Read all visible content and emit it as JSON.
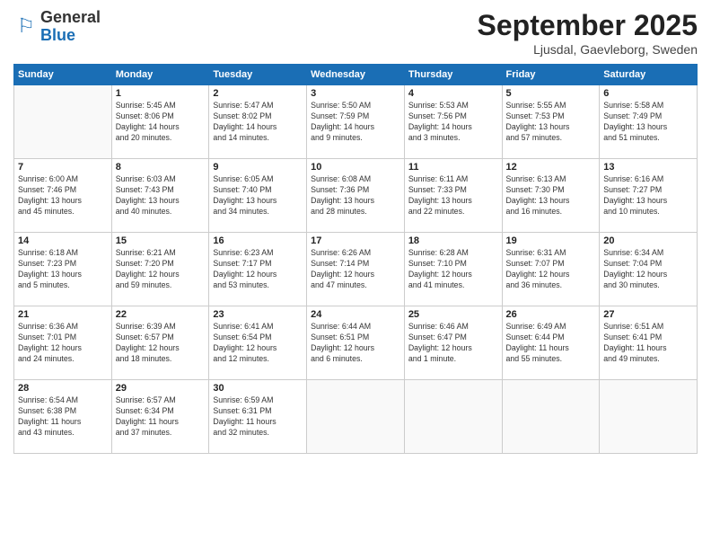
{
  "header": {
    "logo_line1": "General",
    "logo_line2": "Blue",
    "month": "September 2025",
    "location": "Ljusdal, Gaevleborg, Sweden"
  },
  "weekdays": [
    "Sunday",
    "Monday",
    "Tuesday",
    "Wednesday",
    "Thursday",
    "Friday",
    "Saturday"
  ],
  "weeks": [
    [
      {
        "day": "",
        "info": ""
      },
      {
        "day": "1",
        "info": "Sunrise: 5:45 AM\nSunset: 8:06 PM\nDaylight: 14 hours\nand 20 minutes."
      },
      {
        "day": "2",
        "info": "Sunrise: 5:47 AM\nSunset: 8:02 PM\nDaylight: 14 hours\nand 14 minutes."
      },
      {
        "day": "3",
        "info": "Sunrise: 5:50 AM\nSunset: 7:59 PM\nDaylight: 14 hours\nand 9 minutes."
      },
      {
        "day": "4",
        "info": "Sunrise: 5:53 AM\nSunset: 7:56 PM\nDaylight: 14 hours\nand 3 minutes."
      },
      {
        "day": "5",
        "info": "Sunrise: 5:55 AM\nSunset: 7:53 PM\nDaylight: 13 hours\nand 57 minutes."
      },
      {
        "day": "6",
        "info": "Sunrise: 5:58 AM\nSunset: 7:49 PM\nDaylight: 13 hours\nand 51 minutes."
      }
    ],
    [
      {
        "day": "7",
        "info": "Sunrise: 6:00 AM\nSunset: 7:46 PM\nDaylight: 13 hours\nand 45 minutes."
      },
      {
        "day": "8",
        "info": "Sunrise: 6:03 AM\nSunset: 7:43 PM\nDaylight: 13 hours\nand 40 minutes."
      },
      {
        "day": "9",
        "info": "Sunrise: 6:05 AM\nSunset: 7:40 PM\nDaylight: 13 hours\nand 34 minutes."
      },
      {
        "day": "10",
        "info": "Sunrise: 6:08 AM\nSunset: 7:36 PM\nDaylight: 13 hours\nand 28 minutes."
      },
      {
        "day": "11",
        "info": "Sunrise: 6:11 AM\nSunset: 7:33 PM\nDaylight: 13 hours\nand 22 minutes."
      },
      {
        "day": "12",
        "info": "Sunrise: 6:13 AM\nSunset: 7:30 PM\nDaylight: 13 hours\nand 16 minutes."
      },
      {
        "day": "13",
        "info": "Sunrise: 6:16 AM\nSunset: 7:27 PM\nDaylight: 13 hours\nand 10 minutes."
      }
    ],
    [
      {
        "day": "14",
        "info": "Sunrise: 6:18 AM\nSunset: 7:23 PM\nDaylight: 13 hours\nand 5 minutes."
      },
      {
        "day": "15",
        "info": "Sunrise: 6:21 AM\nSunset: 7:20 PM\nDaylight: 12 hours\nand 59 minutes."
      },
      {
        "day": "16",
        "info": "Sunrise: 6:23 AM\nSunset: 7:17 PM\nDaylight: 12 hours\nand 53 minutes."
      },
      {
        "day": "17",
        "info": "Sunrise: 6:26 AM\nSunset: 7:14 PM\nDaylight: 12 hours\nand 47 minutes."
      },
      {
        "day": "18",
        "info": "Sunrise: 6:28 AM\nSunset: 7:10 PM\nDaylight: 12 hours\nand 41 minutes."
      },
      {
        "day": "19",
        "info": "Sunrise: 6:31 AM\nSunset: 7:07 PM\nDaylight: 12 hours\nand 36 minutes."
      },
      {
        "day": "20",
        "info": "Sunrise: 6:34 AM\nSunset: 7:04 PM\nDaylight: 12 hours\nand 30 minutes."
      }
    ],
    [
      {
        "day": "21",
        "info": "Sunrise: 6:36 AM\nSunset: 7:01 PM\nDaylight: 12 hours\nand 24 minutes."
      },
      {
        "day": "22",
        "info": "Sunrise: 6:39 AM\nSunset: 6:57 PM\nDaylight: 12 hours\nand 18 minutes."
      },
      {
        "day": "23",
        "info": "Sunrise: 6:41 AM\nSunset: 6:54 PM\nDaylight: 12 hours\nand 12 minutes."
      },
      {
        "day": "24",
        "info": "Sunrise: 6:44 AM\nSunset: 6:51 PM\nDaylight: 12 hours\nand 6 minutes."
      },
      {
        "day": "25",
        "info": "Sunrise: 6:46 AM\nSunset: 6:47 PM\nDaylight: 12 hours\nand 1 minute."
      },
      {
        "day": "26",
        "info": "Sunrise: 6:49 AM\nSunset: 6:44 PM\nDaylight: 11 hours\nand 55 minutes."
      },
      {
        "day": "27",
        "info": "Sunrise: 6:51 AM\nSunset: 6:41 PM\nDaylight: 11 hours\nand 49 minutes."
      }
    ],
    [
      {
        "day": "28",
        "info": "Sunrise: 6:54 AM\nSunset: 6:38 PM\nDaylight: 11 hours\nand 43 minutes."
      },
      {
        "day": "29",
        "info": "Sunrise: 6:57 AM\nSunset: 6:34 PM\nDaylight: 11 hours\nand 37 minutes."
      },
      {
        "day": "30",
        "info": "Sunrise: 6:59 AM\nSunset: 6:31 PM\nDaylight: 11 hours\nand 32 minutes."
      },
      {
        "day": "",
        "info": ""
      },
      {
        "day": "",
        "info": ""
      },
      {
        "day": "",
        "info": ""
      },
      {
        "day": "",
        "info": ""
      }
    ]
  ]
}
